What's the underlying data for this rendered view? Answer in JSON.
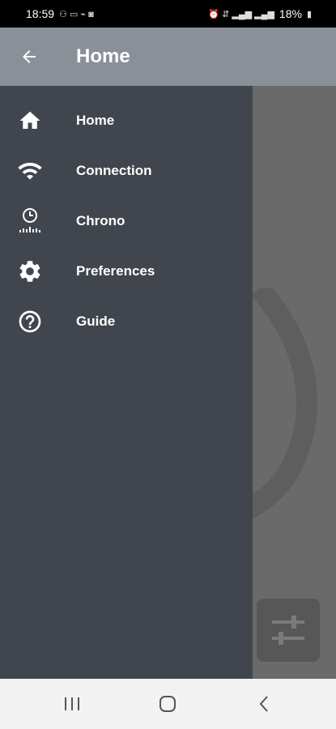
{
  "status_bar": {
    "time": "18:59",
    "battery": "18%"
  },
  "app_bar": {
    "title": "Home"
  },
  "drawer": {
    "items": [
      {
        "label": "Home",
        "icon": "home-icon"
      },
      {
        "label": "Connection",
        "icon": "wifi-icon"
      },
      {
        "label": "Chrono",
        "icon": "chrono-icon"
      },
      {
        "label": "Preferences",
        "icon": "gear-icon"
      },
      {
        "label": "Guide",
        "icon": "help-icon"
      }
    ]
  },
  "colors": {
    "app_bar": "#8a9097",
    "drawer": "#41464e",
    "content": "#6a6a6a",
    "nav_bar": "#f2f2f2"
  }
}
